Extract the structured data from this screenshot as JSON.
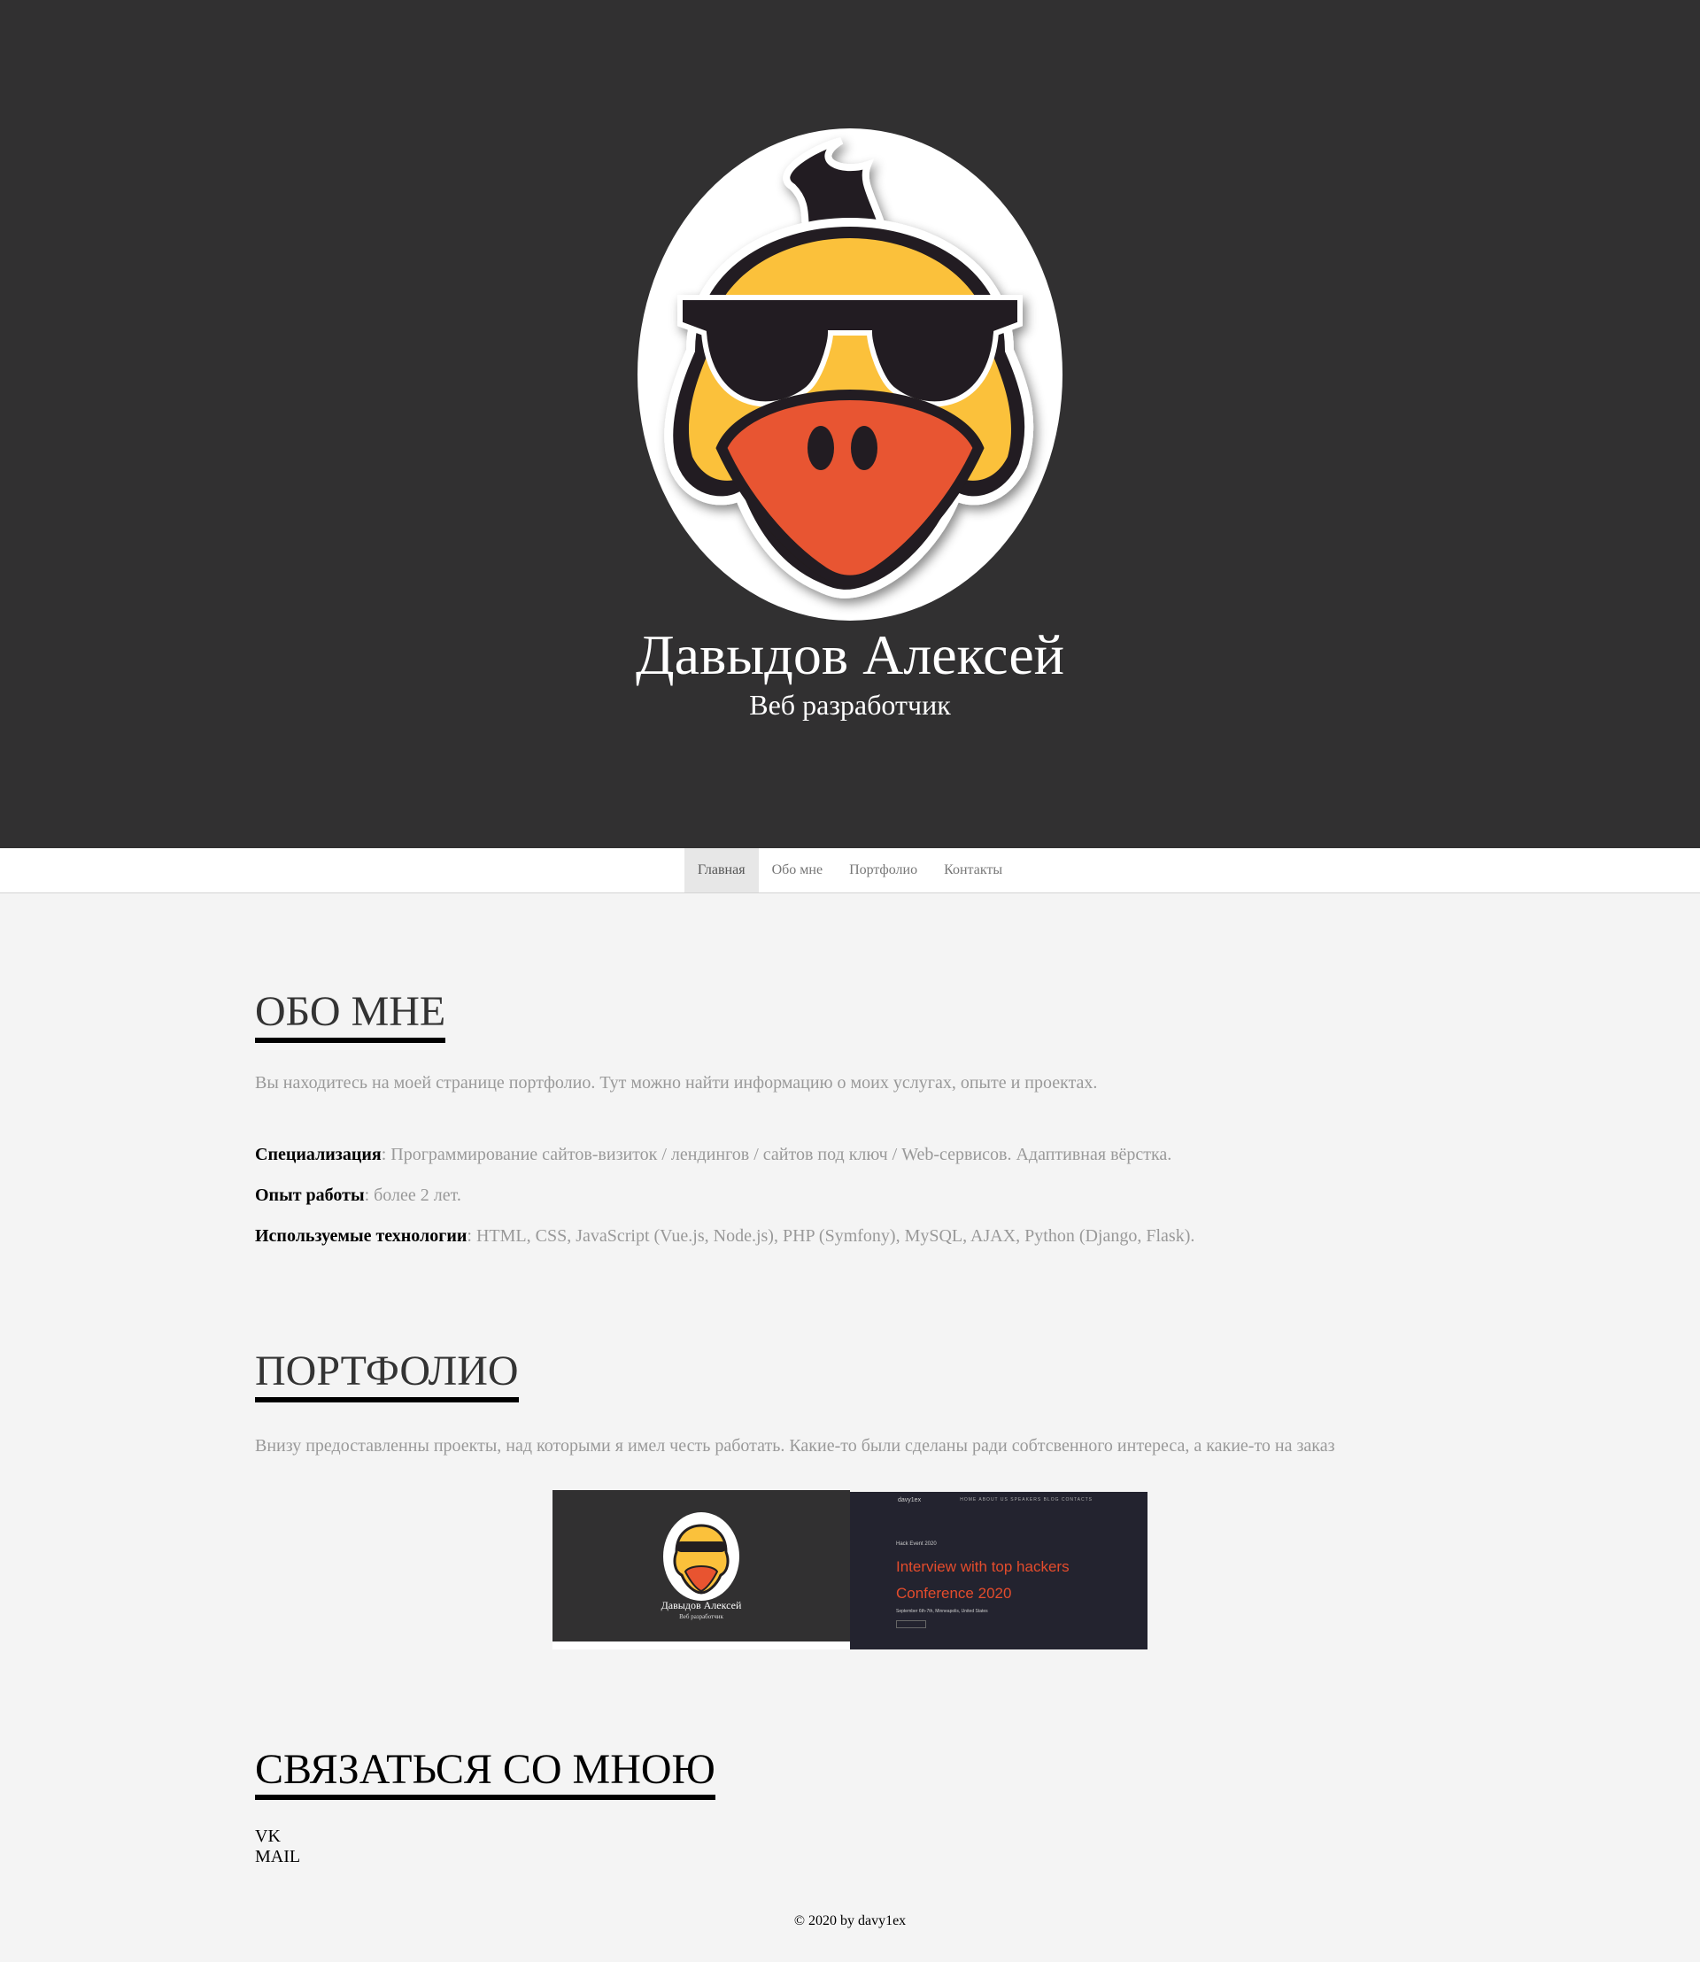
{
  "hero": {
    "name": "Давыдов Алексей",
    "role": "Веб разработчик",
    "avatar_icon": "cool-duck-sunglasses-logo"
  },
  "nav": {
    "items": [
      {
        "label": "Главная",
        "active": true
      },
      {
        "label": "Обо мне",
        "active": false
      },
      {
        "label": "Портфолио",
        "active": false
      },
      {
        "label": "Контакты",
        "active": false
      }
    ]
  },
  "about": {
    "title": "ОБО МНЕ",
    "intro": "Вы находитесь на моей странице портфолио. Тут можно найти информацию о моих услугах, опыте и проектах.",
    "facts": [
      {
        "label": "Специализация",
        "value": ": Программирование сайтов-визиток / лендингов / сайтов под ключ / Web-сервисов. Адаптивная вёрстка."
      },
      {
        "label": "Опыт работы",
        "value": ": более 2 лет."
      },
      {
        "label": "Используемые технологии",
        "value": ": HTML, CSS, JavaScript (Vue.js, Node.js), PHP (Symfony), MySQL, AJAX, Python (Django, Flask)."
      }
    ]
  },
  "portfolio": {
    "title": "ПОРТФОЛИО",
    "intro": "Внизу предоставленны проекты, над которыми я имел честь работать. Какие-то были сделаны ради собтсвенного интереса, а какие-то на заказ",
    "projects": [
      {
        "thumb_name": "Давыдов Алексей",
        "thumb_role": "Веб разработчик"
      },
      {
        "thumb_brand": "davy1ex",
        "thumb_menu": "HOME  ABOUT US  SPEAKERS  BLOG  CONTACTS",
        "thumb_kicker": "Hack Event 2020",
        "thumb_headline": "Interview with top hackers Conference 2020",
        "thumb_sub": "September 6th-7th, Minneapolis, United States"
      }
    ]
  },
  "contact": {
    "title": "СВЯЗАТЬСЯ СО МНОЮ",
    "links": [
      "VK",
      "MAIL"
    ]
  },
  "footer": {
    "text": "© 2020 by davy1ex"
  },
  "colors": {
    "hero_bg": "#313031",
    "page_bg": "#f4f4f4",
    "muted_text": "#999999",
    "duck_yellow": "#fbc13b",
    "duck_beak": "#e85430"
  }
}
